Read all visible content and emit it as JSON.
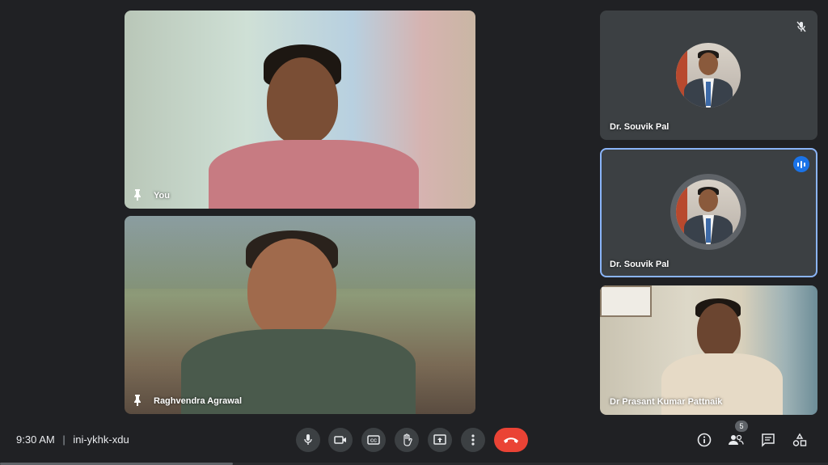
{
  "participants": {
    "you": {
      "name": "You"
    },
    "raghvendra": {
      "name": "Raghvendra Agrawal"
    },
    "souvik_1": {
      "name": "Dr. Souvik Pal"
    },
    "souvik_2": {
      "name": "Dr. Souvik Pal"
    },
    "prasant": {
      "name": "Dr Prasant Kumar Pattnaik"
    }
  },
  "meeting": {
    "time": "9:30 AM",
    "separator": "|",
    "code": "ini-ykhk-xdu",
    "participant_count": "5"
  },
  "controls": {
    "left_icons": [
      "microphone-icon",
      "camera-icon",
      "captions-icon",
      "raise-hand-icon",
      "present-icon",
      "more-options-icon",
      "end-call-icon"
    ],
    "right_icons": [
      "info-icon",
      "people-icon",
      "chat-icon",
      "activities-icon"
    ]
  },
  "colors": {
    "background": "#202124",
    "tile": "#3c4043",
    "accent": "#1a73e8",
    "end_call": "#ea4335"
  }
}
